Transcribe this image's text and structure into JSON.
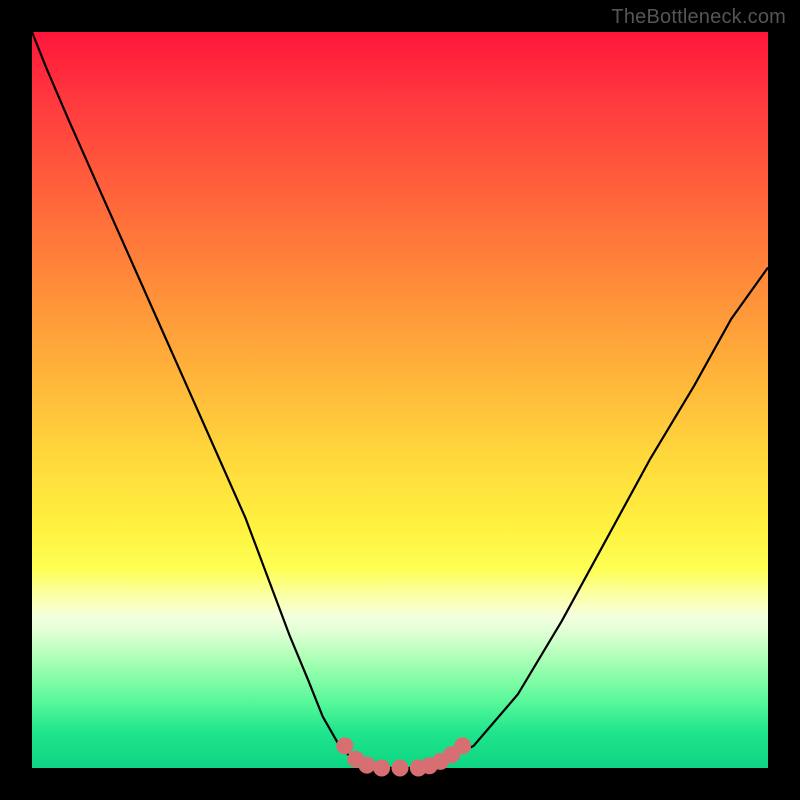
{
  "watermark": "TheBottleneck.com",
  "colors": {
    "frame": "#000000",
    "curve": "#000000",
    "marker_fill": "#d66e72",
    "marker_stroke": "#d66e72"
  },
  "chart_data": {
    "type": "line",
    "title": "",
    "xlabel": "",
    "ylabel": "",
    "xlim": [
      0,
      100
    ],
    "ylim": [
      0,
      100
    ],
    "grid": false,
    "legend": false,
    "series": [
      {
        "name": "bottleneck-curve",
        "x": [
          0,
          2,
          5,
          9,
          13,
          17,
          21,
          25,
          29,
          32,
          35,
          37.5,
          39.5,
          41.5,
          43.5,
          46,
          49,
          52,
          55,
          60,
          66,
          72,
          78,
          84,
          90,
          95,
          100
        ],
        "y": [
          100,
          95,
          88,
          79,
          70,
          61,
          52,
          43,
          34,
          26,
          18,
          12,
          7,
          3.5,
          1.2,
          0.2,
          0,
          0,
          0.5,
          3,
          10,
          20,
          31,
          42,
          52,
          61,
          68
        ]
      }
    ],
    "markers": {
      "name": "near-minimum-markers",
      "x": [
        42.5,
        44,
        45.5,
        47.5,
        50,
        52.5,
        54,
        55.5,
        57,
        58.5
      ],
      "y": [
        3.0,
        1.2,
        0.4,
        0.0,
        0.0,
        0.0,
        0.3,
        0.9,
        1.8,
        3.0
      ],
      "radius": 8
    }
  }
}
